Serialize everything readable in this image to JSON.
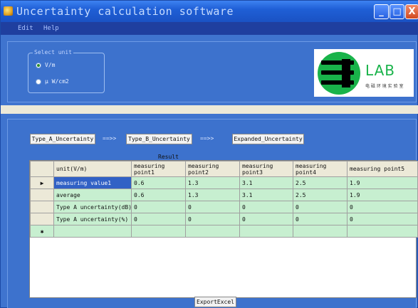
{
  "window": {
    "title": "Uncertainty calculation software",
    "buttons": {
      "minimize": "_",
      "maximize": "□",
      "close": "X"
    }
  },
  "menu": {
    "items": [
      "Edit",
      "Help"
    ]
  },
  "unit_group": {
    "legend": "Select unit",
    "options": [
      {
        "label": "V/m",
        "selected": true
      },
      {
        "label": "μ W/cm2",
        "selected": false
      }
    ]
  },
  "logo": {
    "text": "LAB",
    "subtitle": "电 磁 环 境 实 验 室"
  },
  "flow": {
    "buttons": [
      "Type_A_Uncertainty",
      "Type_B_Uncertainty",
      "Expanded_Uncertainty"
    ],
    "arrow": "==>>"
  },
  "result": {
    "label": "Result",
    "header_first": "unit(V/m)",
    "columns": [
      "measuring point1",
      "measuring point2",
      "measuring point3",
      "measuring point4",
      "measuring point5"
    ],
    "rows": [
      {
        "marker": "▶",
        "label": "measuring value1",
        "values": [
          "0.6",
          "1.3",
          "3.1",
          "2.5",
          "1.9"
        ]
      },
      {
        "marker": "",
        "label": "average",
        "values": [
          "0.6",
          "1.3",
          "3.1",
          "2.5",
          "1.9"
        ]
      },
      {
        "marker": "",
        "label": "Type A uncertainty(dB)",
        "values": [
          "0",
          "0",
          "0",
          "0",
          "0"
        ]
      },
      {
        "marker": "",
        "label": "Type A uncertainty(%)",
        "values": [
          "0",
          "0",
          "0",
          "0",
          "0"
        ]
      }
    ],
    "new_row_marker": "✱"
  },
  "export": {
    "label": "ExportExcel"
  },
  "colors": {
    "window_blue": "#3f74cf",
    "titlebar": "#1f5fd6",
    "grid_cell": "#c7efd0",
    "selected_cell": "#3161c5",
    "logo_green": "#19b34a"
  }
}
